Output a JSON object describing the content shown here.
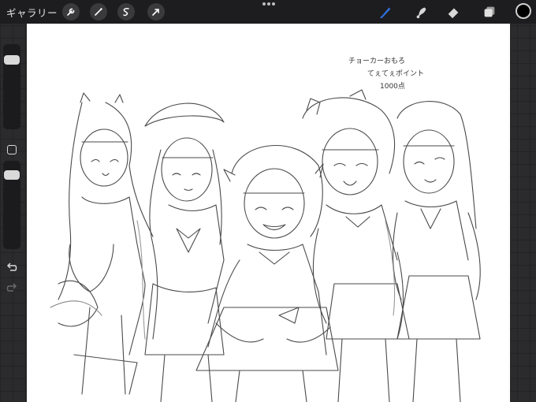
{
  "topbar": {
    "gallery_label": "ギャラリー",
    "left_tools": [
      "wrench-icon",
      "magic-wand-icon",
      "selection-icon",
      "transform-icon"
    ],
    "right_tools": [
      "brush-icon",
      "smudge-icon",
      "eraser-icon",
      "layers-icon"
    ],
    "active_tool": "brush-icon",
    "accent_color": "#2f6fde",
    "current_color": "#000000"
  },
  "sidebar": {
    "tools": [
      "brush-size-slider",
      "modify-button",
      "opacity-slider",
      "undo-icon",
      "redo-icon"
    ]
  },
  "canvas": {
    "note_lines": [
      "チョーカーおもろ",
      "てぇてぇポイント",
      "1000点"
    ]
  }
}
